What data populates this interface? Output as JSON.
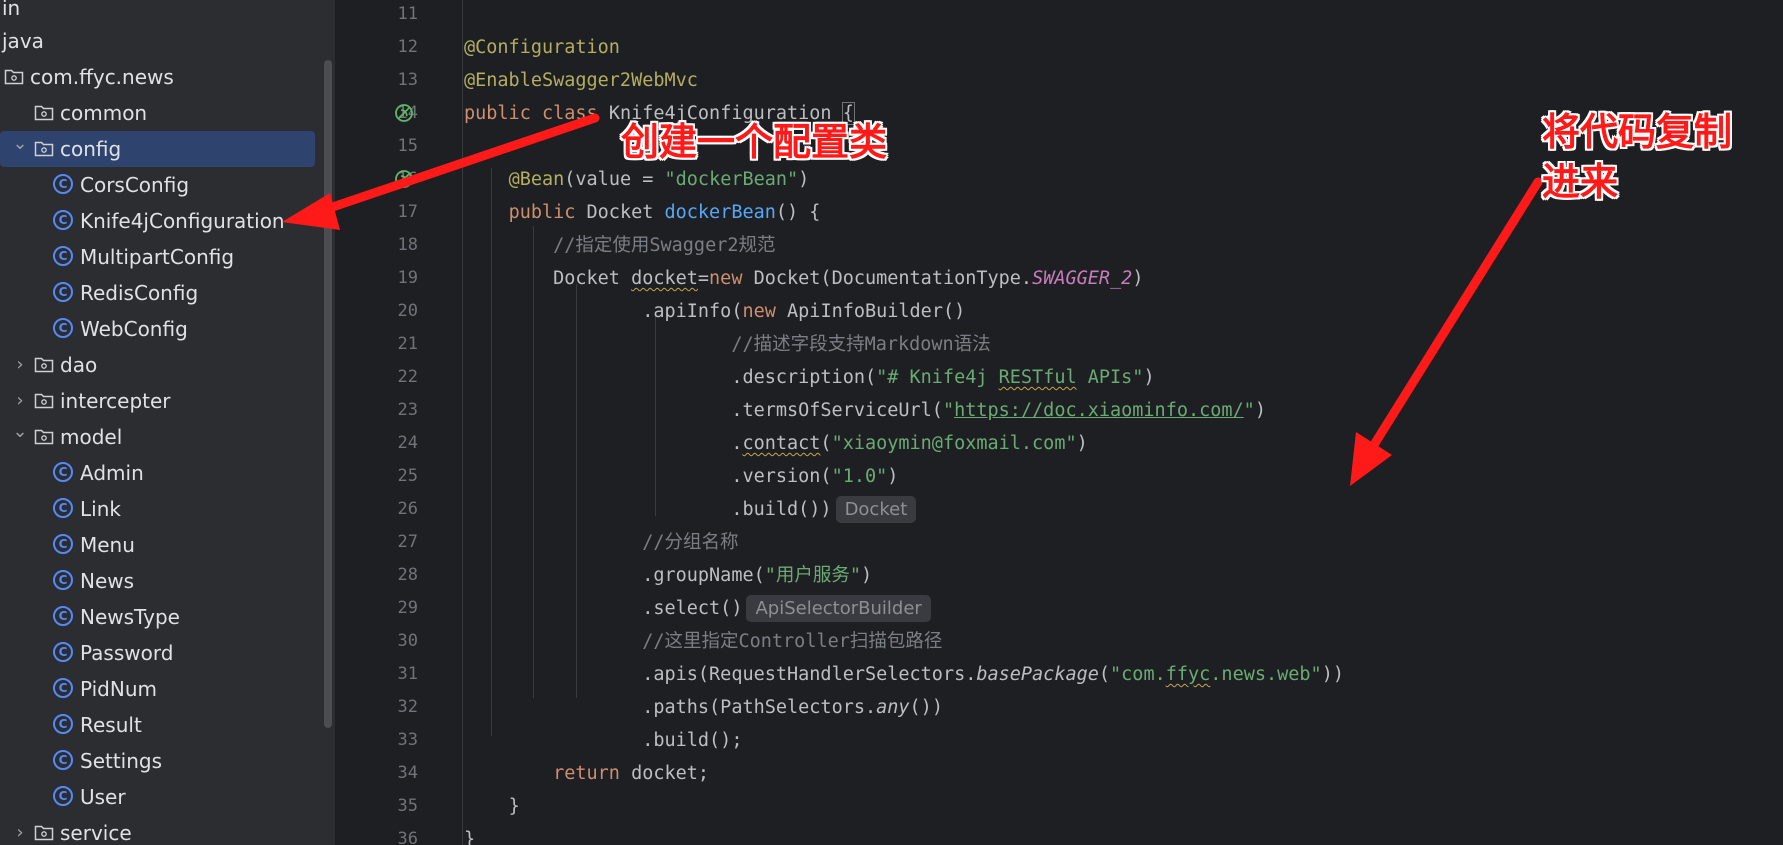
{
  "project_tree": {
    "items": [
      {
        "label": "in",
        "kind": "text",
        "indent": 0
      },
      {
        "label": "java",
        "kind": "text",
        "indent": 0
      },
      {
        "label": "com.ffyc.news",
        "kind": "folder",
        "indent": 0
      },
      {
        "label": "common",
        "kind": "folder",
        "indent": 1
      },
      {
        "label": "config",
        "kind": "folder",
        "indent": 1,
        "expanded": true,
        "selected": true
      },
      {
        "label": "CorsConfig",
        "kind": "class",
        "indent": 2
      },
      {
        "label": "Knife4jConfiguration",
        "kind": "class",
        "indent": 2
      },
      {
        "label": "MultipartConfig",
        "kind": "class",
        "indent": 2
      },
      {
        "label": "RedisConfig",
        "kind": "class",
        "indent": 2
      },
      {
        "label": "WebConfig",
        "kind": "class",
        "indent": 2
      },
      {
        "label": "dao",
        "kind": "folder",
        "indent": 1,
        "expanded": false
      },
      {
        "label": "intercepter",
        "kind": "folder",
        "indent": 1,
        "expanded": false
      },
      {
        "label": "model",
        "kind": "folder",
        "indent": 1,
        "expanded": true
      },
      {
        "label": "Admin",
        "kind": "class",
        "indent": 2
      },
      {
        "label": "Link",
        "kind": "class",
        "indent": 2
      },
      {
        "label": "Menu",
        "kind": "class",
        "indent": 2
      },
      {
        "label": "News",
        "kind": "class",
        "indent": 2
      },
      {
        "label": "NewsType",
        "kind": "class",
        "indent": 2
      },
      {
        "label": "Password",
        "kind": "class",
        "indent": 2
      },
      {
        "label": "PidNum",
        "kind": "class",
        "indent": 2
      },
      {
        "label": "Result",
        "kind": "class",
        "indent": 2
      },
      {
        "label": "Settings",
        "kind": "class",
        "indent": 2
      },
      {
        "label": "User",
        "kind": "class",
        "indent": 2
      },
      {
        "label": "service",
        "kind": "folder",
        "indent": 1,
        "expanded": false
      }
    ],
    "icons": {
      "folder": "folder-icon",
      "class": "class-c-icon",
      "chevron_open": "chevron-down-icon",
      "chevron_closed": "chevron-right-icon"
    }
  },
  "editor": {
    "line_numbers": [
      "11",
      "12",
      "13",
      "14",
      "15",
      "16",
      "17",
      "18",
      "19",
      "20",
      "21",
      "22",
      "23",
      "24",
      "25",
      "26",
      "27",
      "28",
      "29",
      "30",
      "31",
      "32",
      "33",
      "34",
      "35",
      "36"
    ],
    "gutter_icons": {
      "14": "spring-bean-icon",
      "16": "spring-bean-icon"
    },
    "tokens": {
      "l12": "@Configuration",
      "l13": "@EnableSwagger2WebMvc",
      "l14_kw1": "public",
      "l14_kw2": "class",
      "l14_name": "Knife4jConfiguration",
      "l14_brace": "{",
      "l16_ann": "@Bean",
      "l16_p1": "(value = ",
      "l16_str": "\"dockerBean\"",
      "l16_p2": ")",
      "l17_kw": "public",
      "l17_type": " Docket ",
      "l17_fn": "dockerBean",
      "l17_rest": "() {",
      "l18": "//指定使用Swagger2规范",
      "l19_a": "Docket ",
      "l19_var": "docket",
      "l19_eq": "=",
      "l19_kw": "new",
      "l19_b": " Docket(DocumentationType.",
      "l19_const": "SWAGGER_2",
      "l19_c": ")",
      "l20_a": ".apiInfo(",
      "l20_kw": "new",
      "l20_b": " ApiInfoBuilder()",
      "l21": "//描述字段支持Markdown语法",
      "l22_a": ".description(",
      "l22_s1": "\"# Knife4j ",
      "l22_s2": "RESTful",
      "l22_s3": " APIs\"",
      "l22_b": ")",
      "l23_a": ".termsOfServiceUrl(",
      "l23_q1": "\"",
      "l23_url": "https://doc.xiaominfo.com/",
      "l23_q2": "\"",
      "l23_b": ")",
      "l24_a": ".",
      "l24_m": "contact",
      "l24_b": "(",
      "l24_str": "\"xiaoymin@foxmail.com\"",
      "l24_c": ")",
      "l25_a": ".version(",
      "l25_str": "\"1.0\"",
      "l25_b": ")",
      "l26": ".build())",
      "l26_hint": "Docket",
      "l27": "//分组名称",
      "l28_a": ".groupName(",
      "l28_str": "\"用户服务\"",
      "l28_b": ")",
      "l29": ".select()",
      "l29_hint": "ApiSelectorBuilder",
      "l30": "//这里指定Controller扫描包路径",
      "l31_a": ".apis(RequestHandlerSelectors.",
      "l31_m": "basePackage",
      "l31_b": "(",
      "l31_s1": "\"com.",
      "l31_s2": "ffyc",
      "l31_s3": ".news.web\"",
      "l31_c": "))",
      "l32_a": ".paths(PathSelectors.",
      "l32_m": "any",
      "l32_b": "())",
      "l33": ".build();",
      "l34_kw": "return",
      "l34_b": " docket;",
      "l35": "}",
      "l36": "}"
    }
  },
  "annotations": {
    "create_class": "创建一个配置类",
    "copy_code_line1": "将代码复制",
    "copy_code_line2": "进来",
    "color": "#ff1a1a"
  }
}
